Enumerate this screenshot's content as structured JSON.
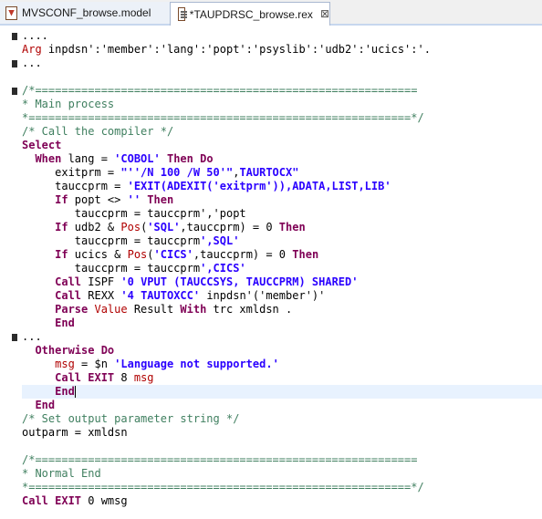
{
  "tabs": [
    {
      "label": "MVSCONF_browse.model",
      "icon": "model-file-icon",
      "active": false
    },
    {
      "label": "*TAUPDRSC_browse.rex",
      "icon": "rexx-file-icon",
      "active": true,
      "close": "⊠"
    }
  ],
  "colors": {
    "keyword": "#7f0055",
    "string": "#2a00ff",
    "comment": "#3f7f5f",
    "function": "#b00000",
    "current_line": "#e8f2fe"
  },
  "code_lines": [
    {
      "marker": true,
      "tokens": [
        {
          "t": "....",
          "c": "plain"
        }
      ]
    },
    {
      "tokens": [
        {
          "t": "Arg",
          "c": "fn"
        },
        {
          "t": " inpdsn':'member':'lang':'popt':'psyslib':'udb2':'ucics':'.",
          "c": "plain"
        }
      ]
    },
    {
      "marker": true,
      "tokens": [
        {
          "t": "...",
          "c": "plain"
        }
      ]
    },
    {
      "tokens": []
    },
    {
      "marker": true,
      "tokens": [
        {
          "t": "/*==========================================================",
          "c": "cmt"
        }
      ]
    },
    {
      "tokens": [
        {
          "t": "* Main process",
          "c": "cmt"
        }
      ]
    },
    {
      "tokens": [
        {
          "t": "*==========================================================*/",
          "c": "cmt"
        }
      ]
    },
    {
      "tokens": [
        {
          "t": "/* Call the compiler */",
          "c": "cmt"
        }
      ]
    },
    {
      "tokens": [
        {
          "t": "Select",
          "c": "kw"
        }
      ]
    },
    {
      "tokens": [
        {
          "t": "  ",
          "c": "plain"
        },
        {
          "t": "When",
          "c": "kw"
        },
        {
          "t": " lang = ",
          "c": "plain"
        },
        {
          "t": "'COBOL'",
          "c": "str"
        },
        {
          "t": " ",
          "c": "plain"
        },
        {
          "t": "Then Do",
          "c": "kw"
        }
      ]
    },
    {
      "tokens": [
        {
          "t": "     exitprm = ",
          "c": "plain"
        },
        {
          "t": "\"''/N 100 /W 50'\"",
          "c": "str"
        },
        {
          "t": ",",
          "c": "plain"
        },
        {
          "t": "TAURTOCX\"",
          "c": "str"
        }
      ]
    },
    {
      "tokens": [
        {
          "t": "     tauccprm = ",
          "c": "plain"
        },
        {
          "t": "'EXIT(ADEXIT('exitprm')),ADATA,LIST,LIB'",
          "c": "str"
        }
      ]
    },
    {
      "tokens": [
        {
          "t": "     ",
          "c": "plain"
        },
        {
          "t": "If",
          "c": "kw"
        },
        {
          "t": " popt <> ",
          "c": "plain"
        },
        {
          "t": "''",
          "c": "str"
        },
        {
          "t": " ",
          "c": "plain"
        },
        {
          "t": "Then",
          "c": "kw"
        }
      ]
    },
    {
      "tokens": [
        {
          "t": "        tauccprm = tauccprm','popt",
          "c": "plain"
        }
      ]
    },
    {
      "tokens": [
        {
          "t": "     ",
          "c": "plain"
        },
        {
          "t": "If",
          "c": "kw"
        },
        {
          "t": " udb2 & ",
          "c": "plain"
        },
        {
          "t": "Pos",
          "c": "fn"
        },
        {
          "t": "(",
          "c": "plain"
        },
        {
          "t": "'SQL'",
          "c": "str"
        },
        {
          "t": ",tauccprm) = 0 ",
          "c": "plain"
        },
        {
          "t": "Then",
          "c": "kw"
        }
      ]
    },
    {
      "tokens": [
        {
          "t": "        tauccprm = tauccprm",
          "c": "plain"
        },
        {
          "t": "',SQL'",
          "c": "str"
        }
      ]
    },
    {
      "tokens": [
        {
          "t": "     ",
          "c": "plain"
        },
        {
          "t": "If",
          "c": "kw"
        },
        {
          "t": " ucics & ",
          "c": "plain"
        },
        {
          "t": "Pos",
          "c": "fn"
        },
        {
          "t": "(",
          "c": "plain"
        },
        {
          "t": "'CICS'",
          "c": "str"
        },
        {
          "t": ",tauccprm) = 0 ",
          "c": "plain"
        },
        {
          "t": "Then",
          "c": "kw"
        }
      ]
    },
    {
      "tokens": [
        {
          "t": "        tauccprm = tauccprm",
          "c": "plain"
        },
        {
          "t": "',CICS'",
          "c": "str"
        }
      ]
    },
    {
      "tokens": [
        {
          "t": "     ",
          "c": "plain"
        },
        {
          "t": "Call",
          "c": "kw"
        },
        {
          "t": " ISPF ",
          "c": "plain"
        },
        {
          "t": "'0 VPUT (TAUCCSYS, TAUCCPRM) SHARED'",
          "c": "str"
        }
      ]
    },
    {
      "tokens": [
        {
          "t": "     ",
          "c": "plain"
        },
        {
          "t": "Call",
          "c": "kw"
        },
        {
          "t": " REXX ",
          "c": "plain"
        },
        {
          "t": "'4 TAUTOXCC'",
          "c": "str"
        },
        {
          "t": " inpdsn'('member')'",
          "c": "plain"
        }
      ]
    },
    {
      "tokens": [
        {
          "t": "     ",
          "c": "plain"
        },
        {
          "t": "Parse",
          "c": "kw"
        },
        {
          "t": " ",
          "c": "plain"
        },
        {
          "t": "Value",
          "c": "fn"
        },
        {
          "t": " Result ",
          "c": "plain"
        },
        {
          "t": "With",
          "c": "kw"
        },
        {
          "t": " trc xmldsn .",
          "c": "plain"
        }
      ]
    },
    {
      "tokens": [
        {
          "t": "     ",
          "c": "plain"
        },
        {
          "t": "End",
          "c": "kw"
        }
      ]
    },
    {
      "marker": true,
      "tokens": [
        {
          "t": "...",
          "c": "plain"
        }
      ]
    },
    {
      "tokens": [
        {
          "t": "  ",
          "c": "plain"
        },
        {
          "t": "Otherwise Do",
          "c": "kw"
        }
      ]
    },
    {
      "tokens": [
        {
          "t": "     ",
          "c": "plain"
        },
        {
          "t": "msg",
          "c": "fn"
        },
        {
          "t": " = $n ",
          "c": "plain"
        },
        {
          "t": "'Language not supported.'",
          "c": "str"
        }
      ]
    },
    {
      "tokens": [
        {
          "t": "     ",
          "c": "plain"
        },
        {
          "t": "Call EXIT",
          "c": "kw"
        },
        {
          "t": " 8 ",
          "c": "plain"
        },
        {
          "t": "msg",
          "c": "fn"
        }
      ]
    },
    {
      "current": true,
      "caret": true,
      "tokens": [
        {
          "t": "     ",
          "c": "plain"
        },
        {
          "t": "End",
          "c": "kw"
        }
      ]
    },
    {
      "tokens": [
        {
          "t": "  ",
          "c": "plain"
        },
        {
          "t": "End",
          "c": "kw"
        }
      ]
    },
    {
      "tokens": [
        {
          "t": "/* Set output parameter string */",
          "c": "cmt"
        }
      ]
    },
    {
      "tokens": [
        {
          "t": "outparm = xmldsn",
          "c": "plain"
        }
      ]
    },
    {
      "tokens": []
    },
    {
      "tokens": [
        {
          "t": "/*==========================================================",
          "c": "cmt"
        }
      ]
    },
    {
      "tokens": [
        {
          "t": "* Normal End",
          "c": "cmt"
        }
      ]
    },
    {
      "tokens": [
        {
          "t": "*==========================================================*/",
          "c": "cmt"
        }
      ]
    },
    {
      "tokens": [
        {
          "t": "Call EXIT",
          "c": "kw"
        },
        {
          "t": " 0 wmsg",
          "c": "plain"
        }
      ]
    }
  ]
}
